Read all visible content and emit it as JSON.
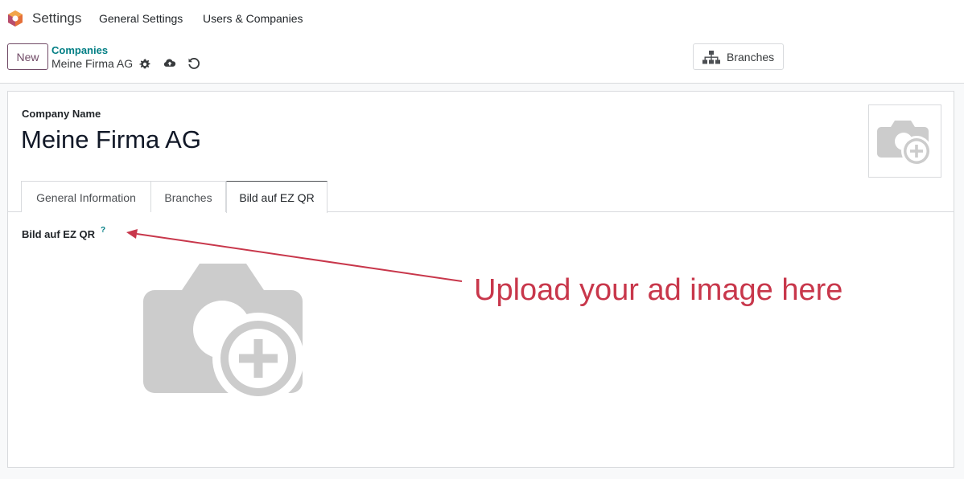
{
  "navbar": {
    "app_name": "Settings",
    "menus": [
      "General Settings",
      "Users & Companies"
    ]
  },
  "control_panel": {
    "new_label": "New",
    "breadcrumb_parent": "Companies",
    "record_name": "Meine Firma AG",
    "smart_button_label": "Branches"
  },
  "form": {
    "company_name_label": "Company Name",
    "company_name": "Meine Firma AG",
    "tabs": [
      "General Information",
      "Branches",
      "Bild auf EZ QR"
    ],
    "active_tab": "Bild auf EZ QR",
    "image_field_label": "Bild auf EZ QR",
    "help_mark": "?"
  },
  "annotation": {
    "text": "Upload your ad image here",
    "color": "#c8374b"
  },
  "colors": {
    "brand": "#714b67",
    "link": "#017e84",
    "placeholder_gray": "#cccccc"
  }
}
